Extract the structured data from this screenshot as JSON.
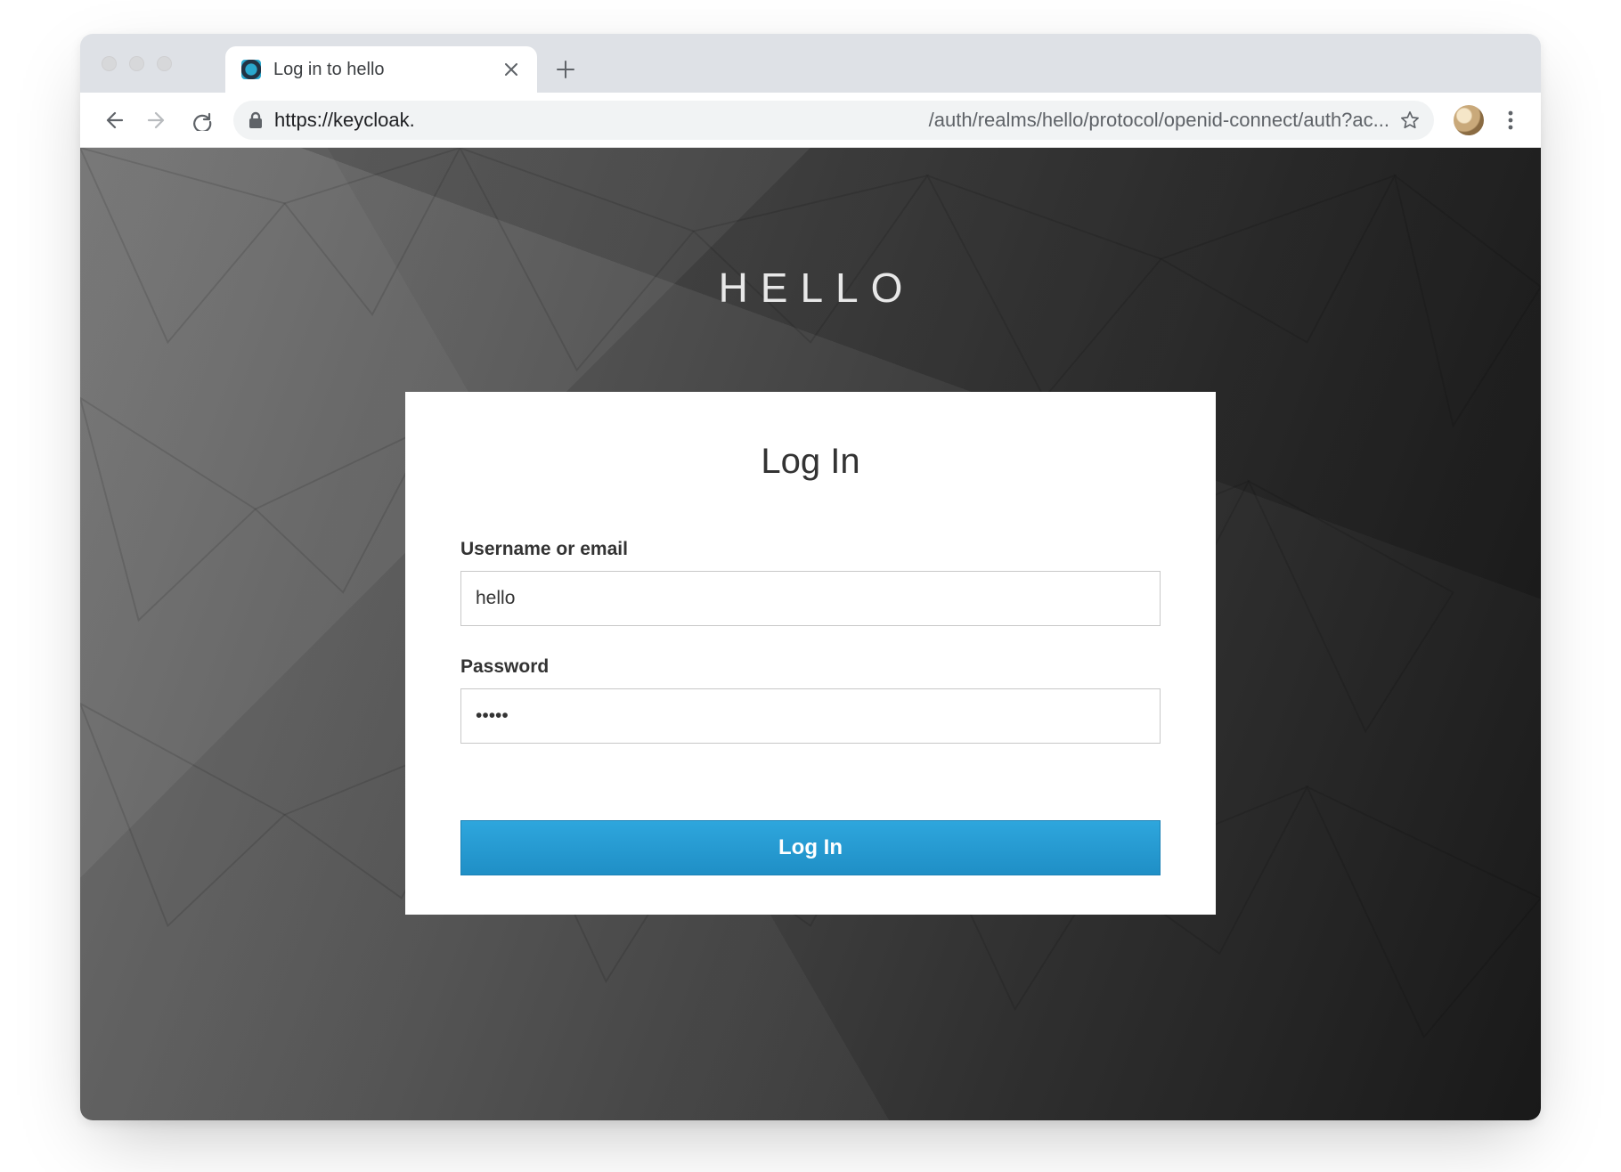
{
  "browser": {
    "tab": {
      "title": "Log in to hello"
    },
    "address": {
      "protocol_host": "https://keycloak.",
      "path_display": "/auth/realms/hello/protocol/openid-connect/auth?ac..."
    }
  },
  "page": {
    "realm_title": "HELLO",
    "card": {
      "header": "Log In",
      "username_label": "Username or email",
      "username_value": "hello",
      "password_label": "Password",
      "password_value": "•••••",
      "submit_label": "Log In"
    }
  }
}
